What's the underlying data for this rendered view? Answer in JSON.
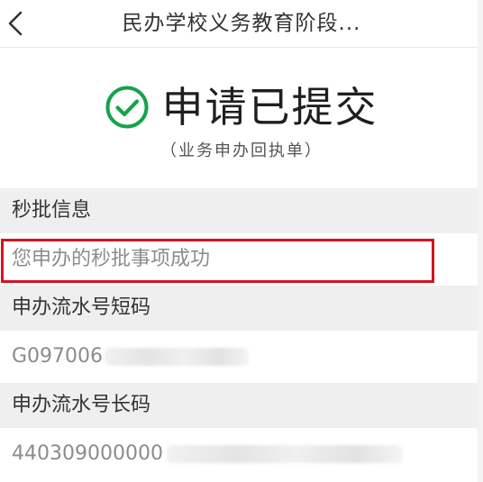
{
  "nav": {
    "back_icon": "chevron-left-icon",
    "title": "民办学校义务教育阶段..."
  },
  "status": {
    "icon": "check-circle-icon",
    "icon_color": "#16a34a",
    "title": "申请已提交",
    "subtitle": "（业务申办回执单）"
  },
  "sections": [
    {
      "header": "秒批信息",
      "value": "您申办的秒批事项成功",
      "value_redacted": false
    },
    {
      "header": "申办流水号短码",
      "value": "G097006",
      "value_redacted": true
    },
    {
      "header": "申办流水号长码",
      "value": "440309000000",
      "value_redacted": true
    }
  ],
  "colors": {
    "highlight_border": "#d4131f",
    "section_header_bg": "#efefef"
  }
}
